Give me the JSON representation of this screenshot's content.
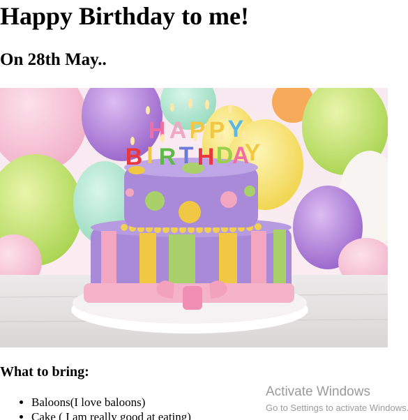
{
  "header": {
    "title": "Happy Birthday to me!",
    "date": "On 28th May.."
  },
  "photo": {
    "icon": "birthday-cake-photo",
    "candle_letters": [
      "H",
      "A",
      "P",
      "P",
      "Y",
      "B",
      "I",
      "R",
      "T",
      "H",
      "D",
      "A",
      "Y"
    ],
    "colors": {
      "balloon_pink": "#f4b8cc",
      "balloon_purple": "#a06fd0",
      "balloon_green": "#b4e05a",
      "balloon_yellow": "#f6dd4e",
      "cake_purple": "#a98ad8",
      "cake_pink": "#f2a6bf",
      "cake_yellow": "#f1c844",
      "cake_green": "#a9d06a"
    }
  },
  "bring": {
    "heading": "What to bring:",
    "items": [
      "Baloons(I love baloons)",
      "Cake ( I am really good at eating)"
    ]
  },
  "watermark": {
    "title": "Activate Windows",
    "subtitle": "Go to Settings to activate Windows."
  }
}
